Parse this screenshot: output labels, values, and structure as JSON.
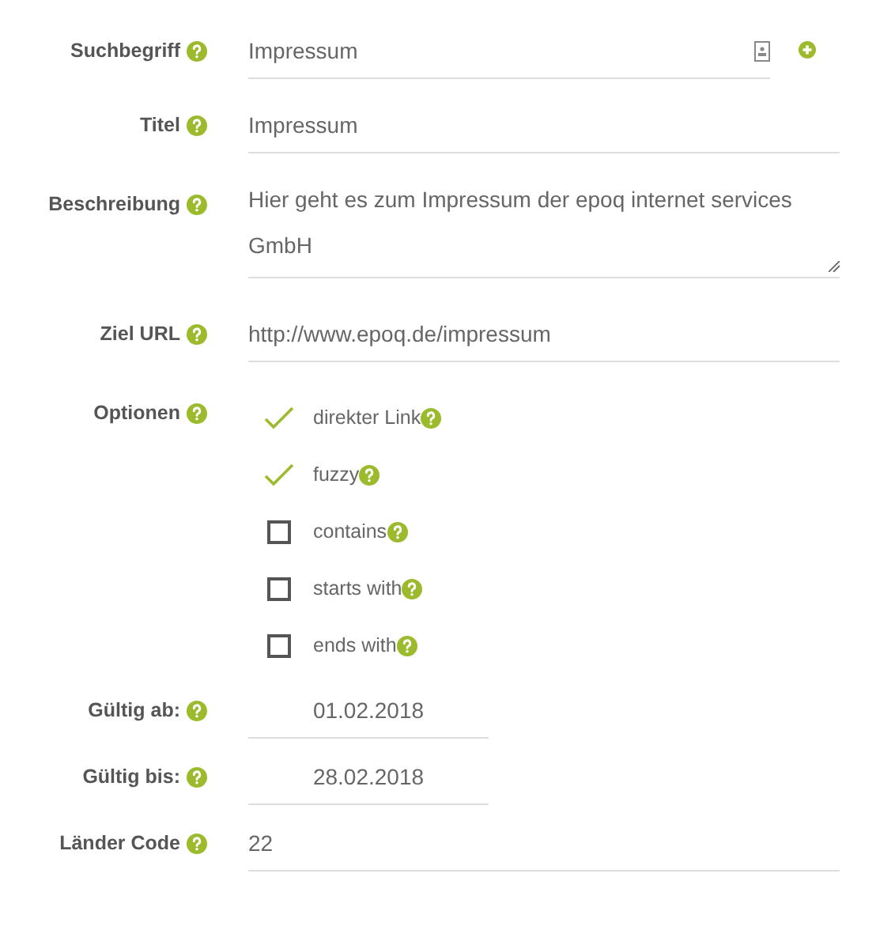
{
  "fields": [
    {
      "label": "Suchbegriff",
      "kind": "search",
      "value": "Impressum"
    },
    {
      "label": "Titel",
      "kind": "text",
      "value": "Impressum"
    },
    {
      "label": "Beschreibung",
      "kind": "textarea",
      "value": "Hier geht es zum Impressum der epoq internet services GmbH"
    },
    {
      "label": "Ziel URL",
      "kind": "text",
      "value": "http://www.epoq.de/impressum"
    },
    {
      "label": "Optionen",
      "kind": "checks",
      "options": [
        {
          "label": "direkter Link",
          "checked": true
        },
        {
          "label": "fuzzy",
          "checked": true
        },
        {
          "label": "contains",
          "checked": false
        },
        {
          "label": "starts with",
          "checked": false
        },
        {
          "label": "ends with",
          "checked": false
        }
      ]
    },
    {
      "label": "Gültig ab:",
      "kind": "date",
      "value": "01.02.2018"
    },
    {
      "label": "Gültig bis:",
      "kind": "date",
      "value": "28.02.2018"
    },
    {
      "label": "Länder Code",
      "kind": "text",
      "value": "22"
    }
  ]
}
